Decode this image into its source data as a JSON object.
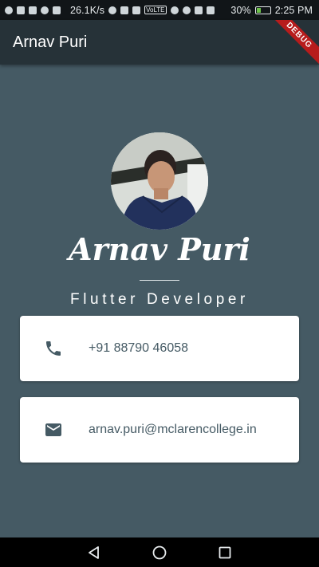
{
  "status_bar": {
    "speed": "26.1K/s",
    "battery": "30%",
    "time": "2:25 PM",
    "volte_label": "VoLTE",
    "network_speed_value": 26.1,
    "battery_level_percent": 30
  },
  "app_bar": {
    "title": "Arnav Puri",
    "debug_banner": "DEBUG"
  },
  "profile": {
    "name": "Arnav Puri",
    "role": "Flutter Developer",
    "avatar_icon": "profile-photo"
  },
  "contacts": [
    {
      "icon": "phone-icon",
      "value": "+91 88790 46058"
    },
    {
      "icon": "email-icon",
      "value": "arnav.puri@mclarencollege.in"
    }
  ],
  "nav_bar": {
    "back_icon": "back-icon",
    "home_icon": "home-icon",
    "recents_icon": "recents-icon"
  },
  "colors": {
    "background": "#455a64",
    "app_bar": "#263238",
    "card": "#ffffff",
    "card_text": "#455a64",
    "debug_ribbon": "#b71c1c"
  }
}
